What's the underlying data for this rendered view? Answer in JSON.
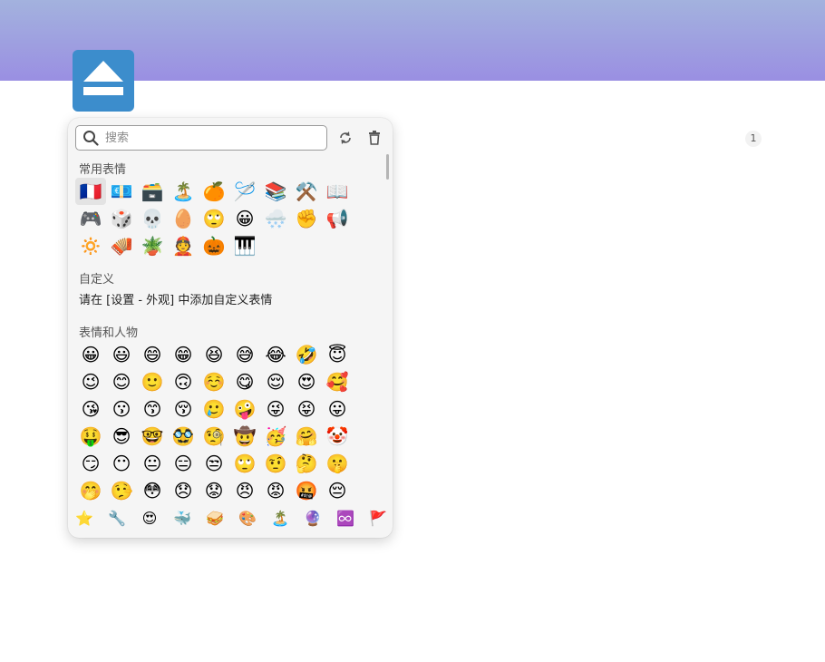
{
  "badge": {
    "count": "1"
  },
  "search": {
    "placeholder": "搜索",
    "value": ""
  },
  "toolbar": {
    "refresh_icon": "refresh-icon",
    "delete_icon": "trash-icon"
  },
  "sections": {
    "recent": {
      "title": "常用表情",
      "emojis": [
        "🇫🇷",
        "💶",
        "🗃️",
        "🏝️",
        "🍊",
        "🪡",
        "📚",
        "⚒️",
        "📖",
        "🎮",
        "🎲",
        "💀",
        "🥚",
        "🙄",
        "😀",
        "🌨️",
        "✊",
        "📢",
        "🔅",
        "🪗",
        "🪴",
        "👲",
        "🎃",
        "🎹"
      ]
    },
    "custom": {
      "title": "自定义",
      "note": "请在 [设置 - 外观] 中添加自定义表情"
    },
    "people": {
      "title": "表情和人物",
      "emojis": [
        "😀",
        "😃",
        "😄",
        "😁",
        "😆",
        "😅",
        "😂",
        "🤣",
        "😇",
        "😉",
        "😊",
        "🙂",
        "🙃",
        "☺️",
        "😋",
        "😌",
        "😍",
        "🥰",
        "😘",
        "😗",
        "😙",
        "😚",
        "🥲",
        "🤪",
        "😜",
        "😝",
        "😛",
        "🤑",
        "😎",
        "🤓",
        "🥸",
        "🧐",
        "🤠",
        "🥳",
        "🤗",
        "🤡",
        "😏",
        "😶",
        "😐",
        "😑",
        "😒",
        "🙄",
        "🤨",
        "🤔",
        "🤫",
        "🤭",
        "🤥",
        "😳",
        "😞",
        "😟",
        "😠",
        "😡",
        "🤬",
        "😔"
      ]
    }
  },
  "footer": {
    "categories": [
      "⭐",
      "🔧",
      "😍",
      "🐳",
      "🥪",
      "🎨",
      "🏝️",
      "🔮",
      "♾️",
      "🚩"
    ]
  }
}
